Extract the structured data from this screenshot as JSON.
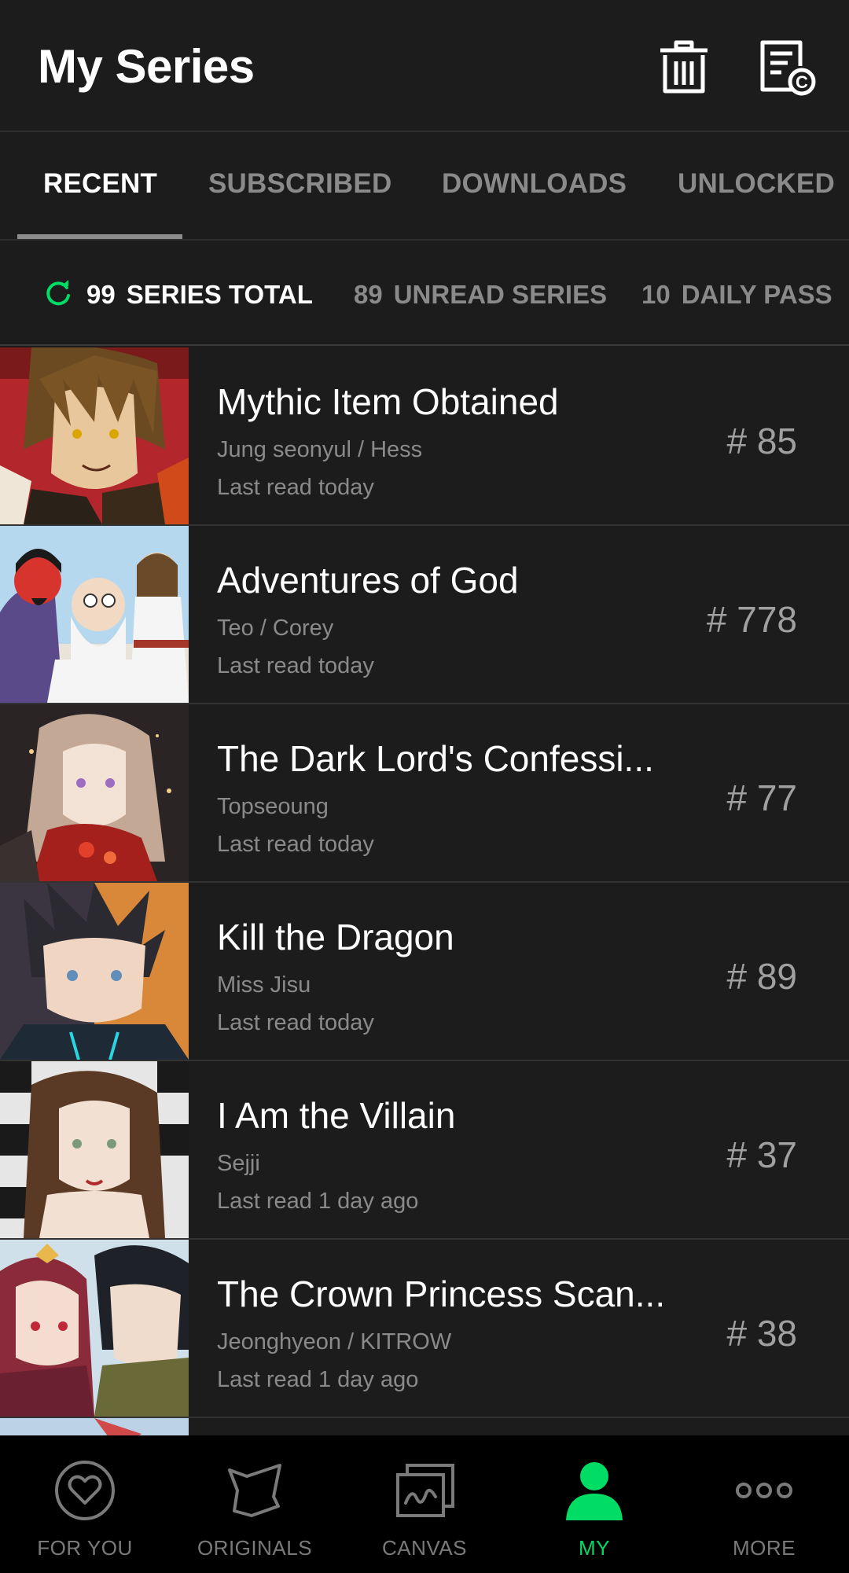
{
  "header": {
    "title": "My Series",
    "icons": [
      "trash-icon",
      "notice-icon"
    ]
  },
  "tabs": [
    {
      "label": "RECENT",
      "active": true
    },
    {
      "label": "SUBSCRIBED",
      "active": false
    },
    {
      "label": "DOWNLOADS",
      "active": false
    },
    {
      "label": "UNLOCKED",
      "active": false
    }
  ],
  "stats": {
    "total": {
      "count": "99",
      "label": "SERIES TOTAL"
    },
    "unread": {
      "count": "89",
      "label": "UNREAD SERIES"
    },
    "daily": {
      "count": "10",
      "label": "DAILY PASS"
    }
  },
  "series": [
    {
      "title": "Mythic Item Obtained",
      "author": "Jung seonyul / Hess",
      "last_read": "Last read today",
      "episode": "# 85"
    },
    {
      "title": "Adventures of God",
      "author": "Teo / Corey",
      "last_read": "Last read today",
      "episode": "# 778"
    },
    {
      "title": "The Dark Lord's Confessi...",
      "author": "Topseoung",
      "last_read": "Last read today",
      "episode": "# 77"
    },
    {
      "title": "Kill the Dragon",
      "author": "Miss Jisu",
      "last_read": "Last read today",
      "episode": "# 89"
    },
    {
      "title": "I Am the Villain",
      "author": "Sejji",
      "last_read": "Last read 1 day ago",
      "episode": "# 37"
    },
    {
      "title": "The Crown Princess Scan...",
      "author": "Jeonghyeon / KITROW",
      "last_read": "Last read 1 day ago",
      "episode": "# 38"
    }
  ],
  "bottom_nav": [
    {
      "label": "FOR YOU",
      "icon": "heart-icon",
      "active": false
    },
    {
      "label": "ORIGINALS",
      "icon": "originals-icon",
      "active": false
    },
    {
      "label": "CANVAS",
      "icon": "canvas-icon",
      "active": false
    },
    {
      "label": "MY",
      "icon": "person-icon",
      "active": true
    },
    {
      "label": "MORE",
      "icon": "more-icon",
      "active": false
    }
  ],
  "colors": {
    "background": "#1c1c1c",
    "accent": "#00dc64",
    "muted_text": "#8a8a8a"
  }
}
